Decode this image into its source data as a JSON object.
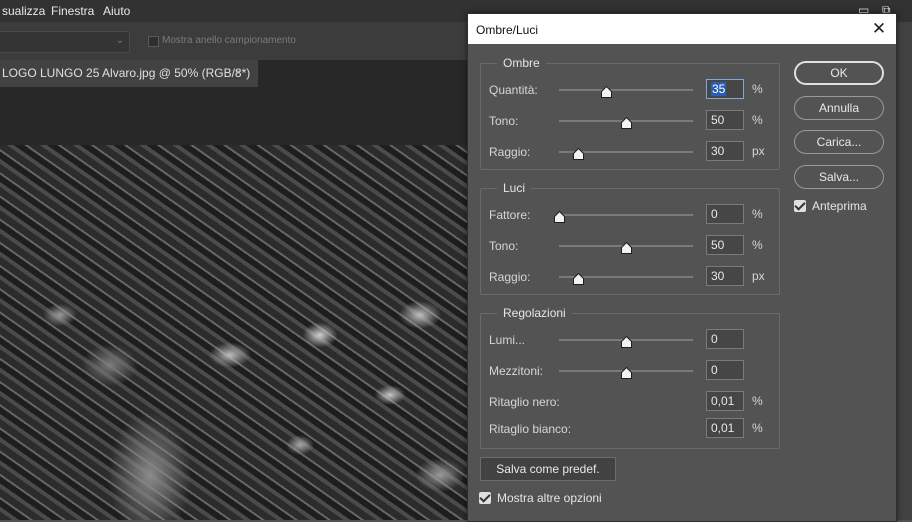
{
  "menubar": {
    "items": [
      "sualizza",
      "Finestra",
      "Aiuto"
    ]
  },
  "options_bar": {
    "sample_ring_label": "Mostra anello campionamento"
  },
  "document": {
    "tab_title": "LOGO LUNGO 25 Alvaro.jpg @ 50% (RGB/8*)",
    "tab_close": "×"
  },
  "dialog": {
    "title": "Ombre/Luci",
    "close_glyph": "✕",
    "shadows": {
      "label": "Ombre",
      "rows": [
        {
          "label": "Quantità:",
          "value": "35",
          "unit": "%",
          "level": 0.35
        },
        {
          "label": "Tono:",
          "value": "50",
          "unit": "%",
          "level": 0.5
        },
        {
          "label": "Raggio:",
          "value": "30",
          "unit": "px",
          "level": 0.14
        }
      ]
    },
    "highlights": {
      "label": "Luci",
      "rows": [
        {
          "label": "Fattore:",
          "value": "0",
          "unit": "%",
          "level": 0.0
        },
        {
          "label": "Tono:",
          "value": "50",
          "unit": "%",
          "level": 0.5
        },
        {
          "label": "Raggio:",
          "value": "30",
          "unit": "px",
          "level": 0.14
        }
      ]
    },
    "adjustments": {
      "label": "Regolazioni",
      "rows": [
        {
          "label": "Lumi...",
          "value": "0",
          "level": 0.5
        },
        {
          "label": "Mezzitoni:",
          "value": "0",
          "level": 0.5
        },
        {
          "label": "Ritaglio nero:",
          "value": "0,01",
          "unit": "%"
        },
        {
          "label": "Ritaglio bianco:",
          "value": "0,01",
          "unit": "%"
        }
      ]
    },
    "buttons": {
      "ok": "OK",
      "cancel": "Annulla",
      "load": "Carica...",
      "save": "Salva..."
    },
    "preview": {
      "label": "Anteprima",
      "checked": true
    },
    "save_default": "Salva come predef.",
    "more_options": {
      "label": "Mostra altre opzioni",
      "checked": true
    }
  }
}
